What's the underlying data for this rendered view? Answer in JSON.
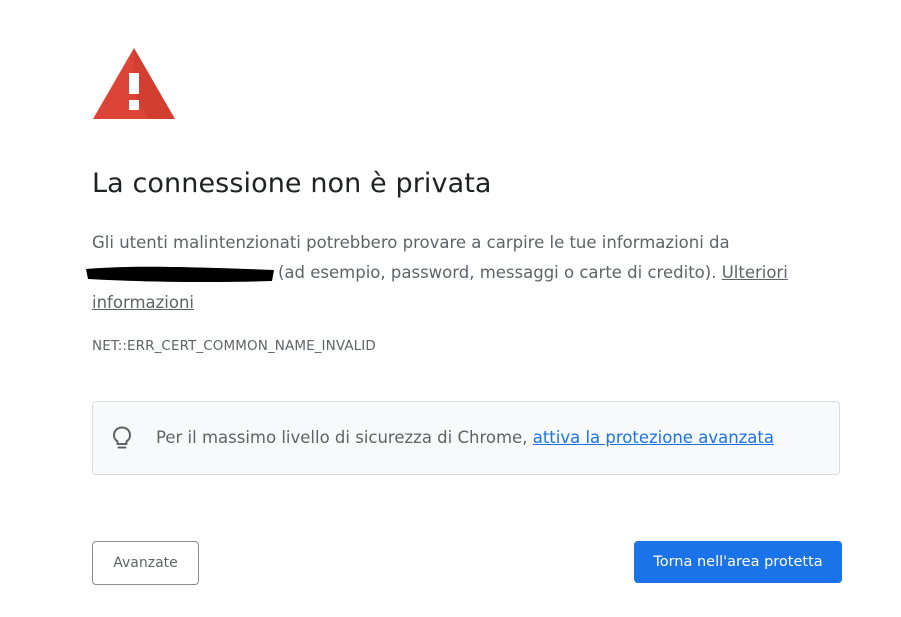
{
  "interstitial": {
    "icon": "warning-triangle-icon",
    "icon_color": "#db4437",
    "title": "La connessione non è privata",
    "message_before": "Gli utenti malintenzionati potrebbero provare a carpire le tue informazioni da",
    "message_after": "(ad esempio, password, messaggi o carte di credito).",
    "learn_more_label": "Ulteriori informazioni",
    "error_code": "NET::ERR_CERT_COMMON_NAME_INVALID"
  },
  "enhanced_protection": {
    "icon": "lightbulb-icon",
    "text": "Per il massimo livello di sicurezza di Chrome,",
    "link_label": "attiva la protezione avanzata",
    "link_color": "#1a73e8"
  },
  "buttons": {
    "advanced_label": "Avanzate",
    "back_to_safety_label": "Torna nell'area protetta",
    "primary_color": "#1a73e8"
  }
}
